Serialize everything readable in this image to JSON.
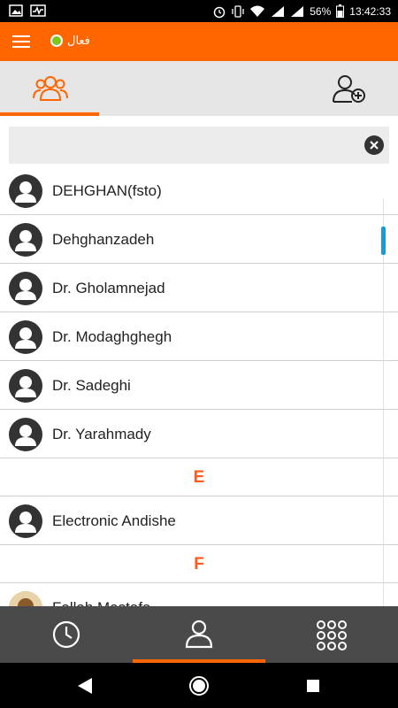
{
  "status_bar": {
    "battery": "56%",
    "time": "13:42:33"
  },
  "app_bar": {
    "status_label": "فعال",
    "status_color": "#7ec51c",
    "accent_color": "#ff6600"
  },
  "tabs": [
    {
      "icon": "contacts-group-icon",
      "selected": true
    },
    {
      "icon": "add-contact-icon",
      "selected": false
    }
  ],
  "search": {
    "value": "",
    "placeholder": "",
    "clear_icon": "close-icon"
  },
  "contacts": {
    "rows": [
      {
        "type": "contact",
        "name": "DEHGHAN(fsto)"
      },
      {
        "type": "contact",
        "name": "Dehghanzadeh"
      },
      {
        "type": "contact",
        "name": "Dr. Gholamnejad"
      },
      {
        "type": "contact",
        "name": "Dr. Modaghghegh"
      },
      {
        "type": "contact",
        "name": "Dr. Sadeghi"
      },
      {
        "type": "contact",
        "name": "Dr. Yarahmady"
      },
      {
        "type": "section",
        "letter": "E"
      },
      {
        "type": "contact",
        "name": "Electronic Andishe"
      },
      {
        "type": "section",
        "letter": "F"
      },
      {
        "type": "contact",
        "name": "Fallah Mostafa",
        "photo": true
      }
    ]
  },
  "bottom_nav": [
    {
      "icon": "clock-icon",
      "selected": false
    },
    {
      "icon": "person-icon",
      "selected": true
    },
    {
      "icon": "dialpad-icon",
      "selected": false
    }
  ]
}
